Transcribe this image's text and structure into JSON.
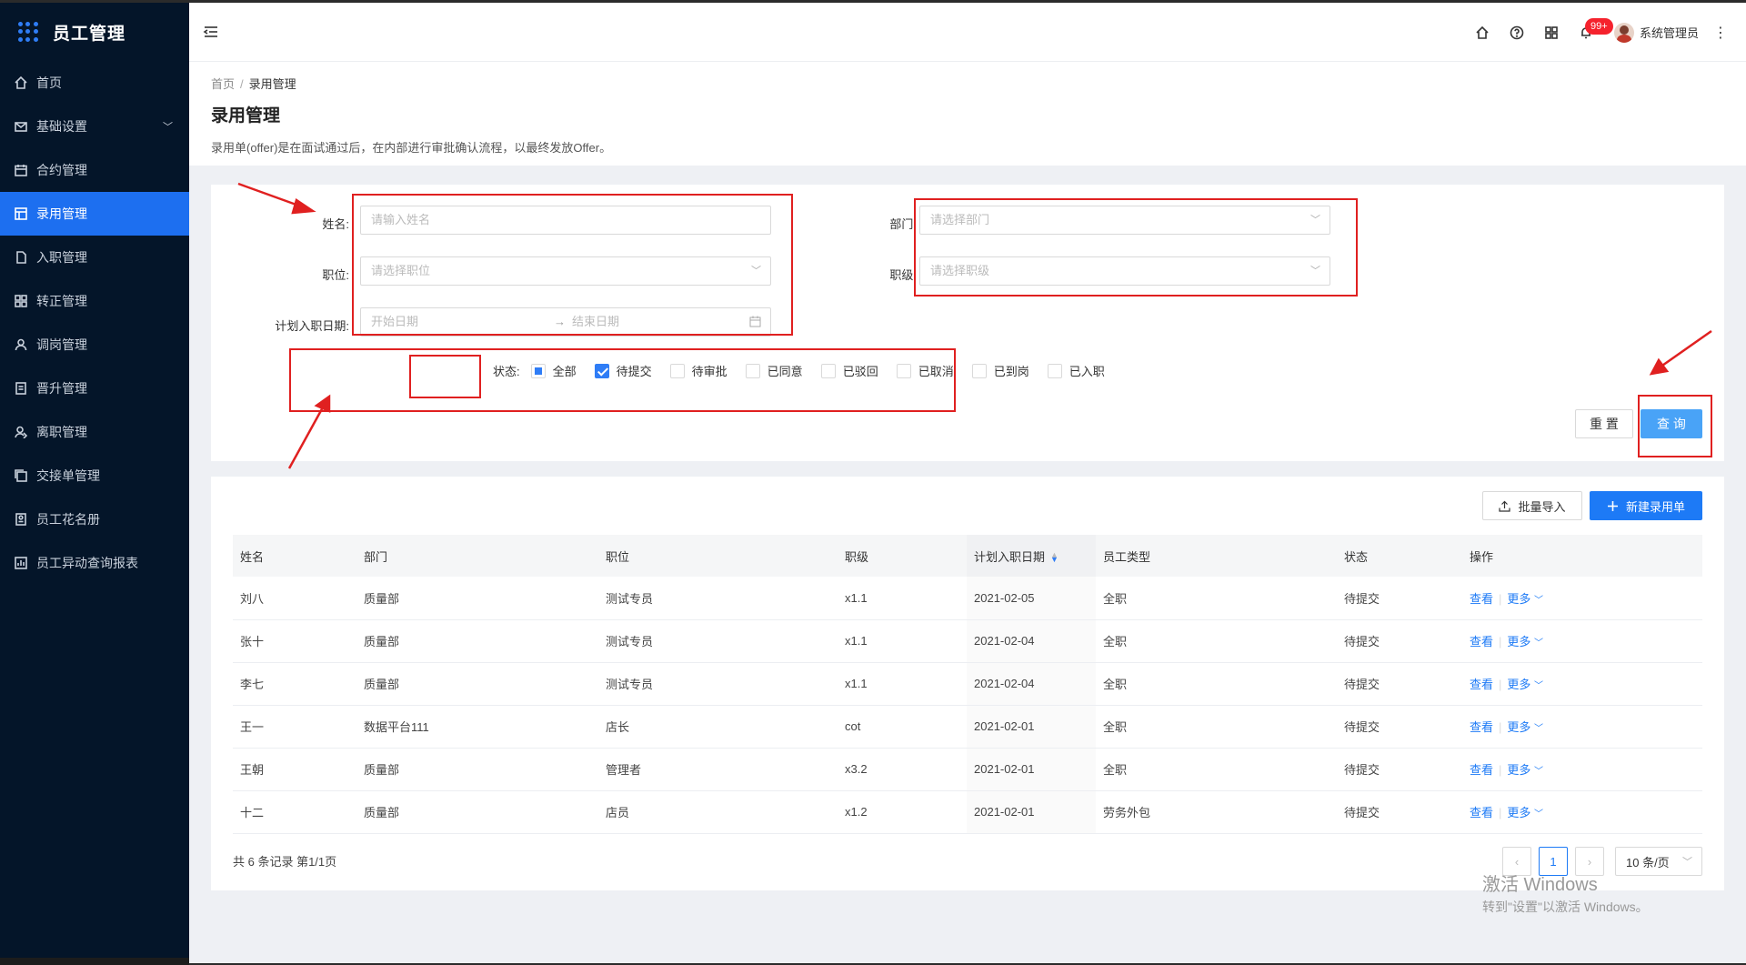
{
  "app": {
    "title": "员工管理"
  },
  "sidebar": {
    "items": [
      {
        "label": "首页",
        "icon": "home-icon"
      },
      {
        "label": "基础设置",
        "icon": "mail-icon",
        "expandable": true
      },
      {
        "label": "合约管理",
        "icon": "calendar-icon"
      },
      {
        "label": "录用管理",
        "icon": "table-icon",
        "active": true
      },
      {
        "label": "入职管理",
        "icon": "file-icon"
      },
      {
        "label": "转正管理",
        "icon": "grid-icon"
      },
      {
        "label": "调岗管理",
        "icon": "user-icon"
      },
      {
        "label": "晋升管理",
        "icon": "report-icon"
      },
      {
        "label": "离职管理",
        "icon": "user-leave-icon"
      },
      {
        "label": "交接单管理",
        "icon": "copy-icon"
      },
      {
        "label": "员工花名册",
        "icon": "roster-icon"
      },
      {
        "label": "员工异动查询报表",
        "icon": "chart-icon"
      }
    ]
  },
  "header": {
    "notifications_badge": "99+",
    "user_name": "系统管理员"
  },
  "breadcrumb": {
    "home": "首页",
    "current": "录用管理"
  },
  "page": {
    "title": "录用管理",
    "description": "录用单(offer)是在面试通过后，在内部进行审批确认流程，以最终发放Offer。"
  },
  "filters": {
    "name_label": "姓名:",
    "name_placeholder": "请输入姓名",
    "position_label": "职位:",
    "position_placeholder": "请选择职位",
    "date_label": "计划入职日期:",
    "date_start_placeholder": "开始日期",
    "date_end_placeholder": "结束日期",
    "dept_label": "部门:",
    "dept_placeholder": "请选择部门",
    "level_label": "职级:",
    "level_placeholder": "请选择职级",
    "status_label": "状态:",
    "status_options": [
      {
        "label": "全部",
        "state": "indeterminate"
      },
      {
        "label": "待提交",
        "state": "checked"
      },
      {
        "label": "待审批",
        "state": "unchecked"
      },
      {
        "label": "已同意",
        "state": "unchecked"
      },
      {
        "label": "已驳回",
        "state": "unchecked"
      },
      {
        "label": "已取消",
        "state": "unchecked"
      },
      {
        "label": "已到岗",
        "state": "unchecked"
      },
      {
        "label": "已入职",
        "state": "unchecked"
      }
    ],
    "reset_label": "重 置",
    "query_label": "查 询"
  },
  "table": {
    "import_label": "批量导入",
    "create_label": "新建录用单",
    "columns": [
      "姓名",
      "部门",
      "职位",
      "职级",
      "计划入职日期",
      "员工类型",
      "状态",
      "操作"
    ],
    "rows": [
      [
        "刘八",
        "质量部",
        "测试专员",
        "x1.1",
        "2021-02-05",
        "全职",
        "待提交"
      ],
      [
        "张十",
        "质量部",
        "测试专员",
        "x1.1",
        "2021-02-04",
        "全职",
        "待提交"
      ],
      [
        "李七",
        "质量部",
        "测试专员",
        "x1.1",
        "2021-02-04",
        "全职",
        "待提交"
      ],
      [
        "王一",
        "数据平台111",
        "店长",
        "cot",
        "2021-02-01",
        "全职",
        "待提交"
      ],
      [
        "王朝",
        "质量部",
        "管理者",
        "x3.2",
        "2021-02-01",
        "全职",
        "待提交"
      ],
      [
        "十二",
        "质量部",
        "店员",
        "x1.2",
        "2021-02-01",
        "劳务外包",
        "待提交"
      ]
    ],
    "op_view": "查看",
    "op_more": "更多",
    "total_text": "共 6 条记录 第1/1页",
    "current_page": "1",
    "page_size": "10 条/页"
  },
  "watermark": {
    "line1": "激活 Windows",
    "line2": "转到\"设置\"以激活 Windows。"
  },
  "colors": {
    "sidebar_bg": "#041529",
    "active": "#1d6ff0",
    "primary": "#1d7af6",
    "annotation": "#e02020"
  }
}
